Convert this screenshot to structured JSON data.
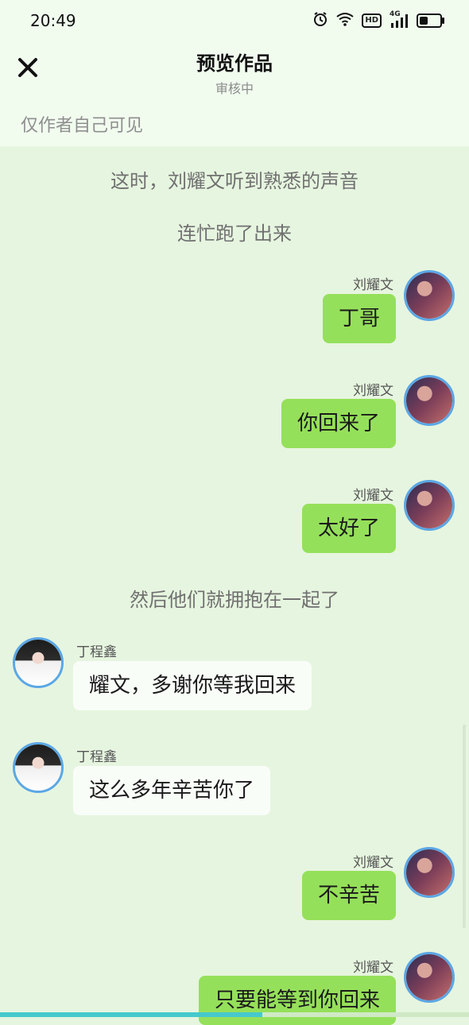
{
  "status_bar": {
    "time": "20:49",
    "icons": [
      "alarm-icon",
      "wifi-icon",
      "hd-icon",
      "4g-signal-icon",
      "battery-icon"
    ],
    "hd_label": "HD",
    "network_label": "4G"
  },
  "header": {
    "title": "预览作品",
    "subtitle": "审核中",
    "visibility_note": "仅作者自己可见",
    "close_icon": "close-icon"
  },
  "chat": {
    "narrations": [
      "这时，刘耀文听到熟悉的声音",
      "连忙跑了出来",
      "然后他们就拥抱在一起了"
    ],
    "messages": [
      {
        "sender": "刘耀文",
        "text": "丁哥"
      },
      {
        "sender": "刘耀文",
        "text": "你回来了"
      },
      {
        "sender": "刘耀文",
        "text": "太好了"
      },
      {
        "sender": "丁程鑫",
        "text": "耀文，多谢你等我回来"
      },
      {
        "sender": "丁程鑫",
        "text": "这么多年辛苦你了"
      },
      {
        "sender": "刘耀文",
        "text": "不辛苦"
      },
      {
        "sender": "刘耀文",
        "text": "只要能等到你回来"
      }
    ]
  },
  "colors": {
    "background": "#e6f5df",
    "header_background": "#f1fcef",
    "right_bubble": "#95e05a",
    "left_bubble": "#f9fdf8",
    "avatar_border": "#5aa7e6",
    "progress": "#46c9cc"
  },
  "progress": 0.56
}
